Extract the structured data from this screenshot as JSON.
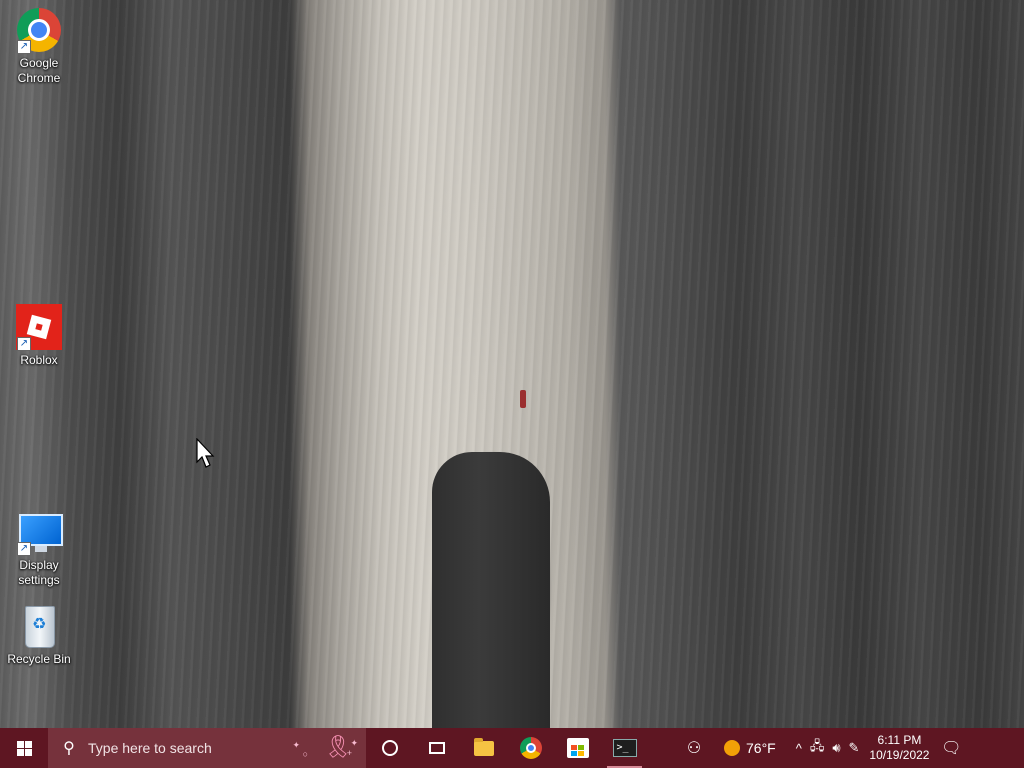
{
  "desktop": {
    "icons": [
      {
        "label": "Google Chrome",
        "icon": "chrome-icon"
      },
      {
        "label": "Roblox",
        "icon": "roblox-icon"
      },
      {
        "label": "Display settings",
        "icon": "display-settings-icon"
      },
      {
        "label": "Recycle Bin",
        "icon": "recycle-bin-icon"
      }
    ]
  },
  "taskbar": {
    "search_placeholder": "Type here to search",
    "pinned": [
      {
        "name": "cortana-icon"
      },
      {
        "name": "task-view-icon"
      },
      {
        "name": "file-explorer-icon"
      },
      {
        "name": "chrome-icon"
      },
      {
        "name": "microsoft-store-icon"
      },
      {
        "name": "terminal-icon"
      }
    ],
    "weather": {
      "temperature": "76°F",
      "icon": "sun-icon"
    },
    "tray": {
      "chevron": "^",
      "network": "network-icon",
      "volume": "volume-icon",
      "pen": "pen-icon"
    },
    "clock": {
      "time": "6:11 PM",
      "date": "10/19/2022"
    },
    "colors": {
      "taskbar": "#5e1622",
      "search_box": "#76323c"
    }
  }
}
